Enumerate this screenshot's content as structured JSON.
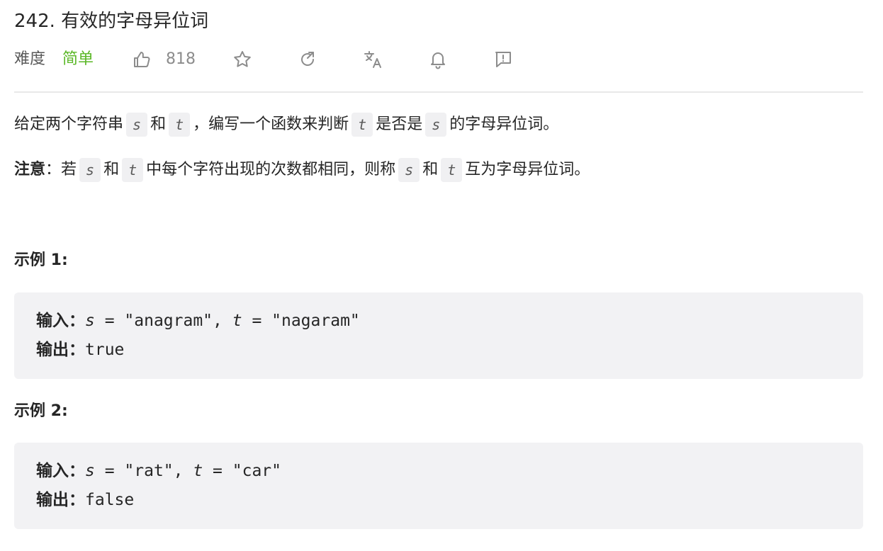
{
  "problem": {
    "title": "242. 有效的字母异位词",
    "difficulty_label": "难度",
    "difficulty_value": "简单",
    "likes": "818",
    "icons": [
      "thumbs-up-icon",
      "star-icon",
      "share-icon",
      "translate-icon",
      "bell-icon",
      "feedback-icon"
    ]
  },
  "description": {
    "line1": {
      "part1": "给定两个字符串",
      "s": "s",
      "part2": "和",
      "t": "t",
      "part3": "，编写一个函数来判断",
      "t2": "t",
      "part4": "是否是",
      "s2": "s",
      "part5": "的字母异位词。"
    },
    "line2": {
      "note_label": "注意",
      "colon": "：若",
      "s": "s",
      "part2": "和",
      "t": "t",
      "part3": "中每个字符出现的次数都相同，则称",
      "s2": "s",
      "part4": "和",
      "t2": "t",
      "part5": "互为字母异位词。"
    }
  },
  "examples": [
    {
      "title": "示例 1:",
      "input_label": "输入：",
      "input_s": "s",
      "input_mid": " = \"anagram\", ",
      "input_t": "t",
      "input_end": " = \"nagaram\"",
      "output_label": "输出：",
      "output_value": "true"
    },
    {
      "title": "示例 2:",
      "input_label": "输入：",
      "input_s": "s",
      "input_mid": " = \"rat\", ",
      "input_t": "t",
      "input_end": " = \"car\"",
      "output_label": "输出：",
      "output_value": "false"
    }
  ],
  "colors": {
    "easy": "#5ab726",
    "icon": "#8c8c8c",
    "code_bg": "#f2f2f4"
  }
}
